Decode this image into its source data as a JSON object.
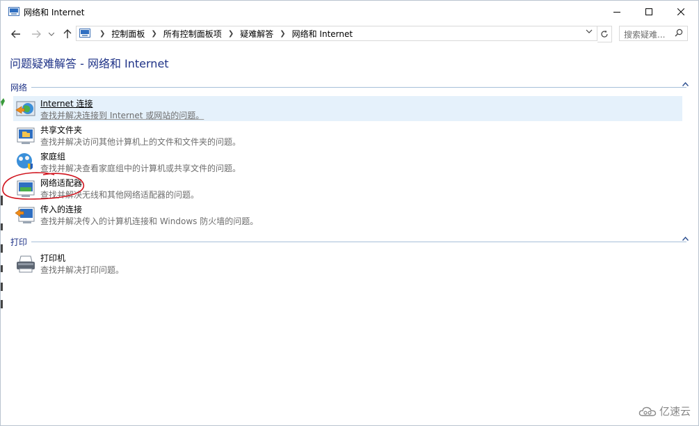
{
  "window": {
    "title": "网络和 Internet"
  },
  "nav": {
    "breadcrumbs": [
      "控制面板",
      "所有控制面板项",
      "疑难解答",
      "网络和 Internet"
    ],
    "search_placeholder": "搜索疑难..."
  },
  "page": {
    "heading": "问题疑难解答 - 网络和 Internet"
  },
  "groups": [
    {
      "label": "网络",
      "items": [
        {
          "name": "Internet 连接",
          "desc": "查找并解决连接到 Internet 或网站的问题。",
          "icon": "internet-connection-icon"
        },
        {
          "name": "共享文件夹",
          "desc": "查找并解决访问其他计算机上的文件和文件夹的问题。",
          "icon": "shared-folders-icon"
        },
        {
          "name": "家庭组",
          "desc": "查找并解决查看家庭组中的计算机或共享文件的问题。",
          "icon": "homegroup-icon"
        },
        {
          "name": "网络适配器",
          "desc": "查找并解决无线和其他网络适配器的问题。",
          "icon": "network-adapter-icon"
        },
        {
          "name": "传入的连接",
          "desc": "查找并解决传入的计算机连接和 Windows 防火墙的问题。",
          "icon": "incoming-connections-icon"
        }
      ]
    },
    {
      "label": "打印",
      "items": [
        {
          "name": "打印机",
          "desc": "查找并解决打印问题。",
          "icon": "printer-icon"
        }
      ]
    }
  ],
  "watermark": {
    "text": "亿速云"
  },
  "colors": {
    "heading": "#1e3287",
    "hover_bg": "#e5f1fb",
    "annotation": "#d0141e"
  }
}
